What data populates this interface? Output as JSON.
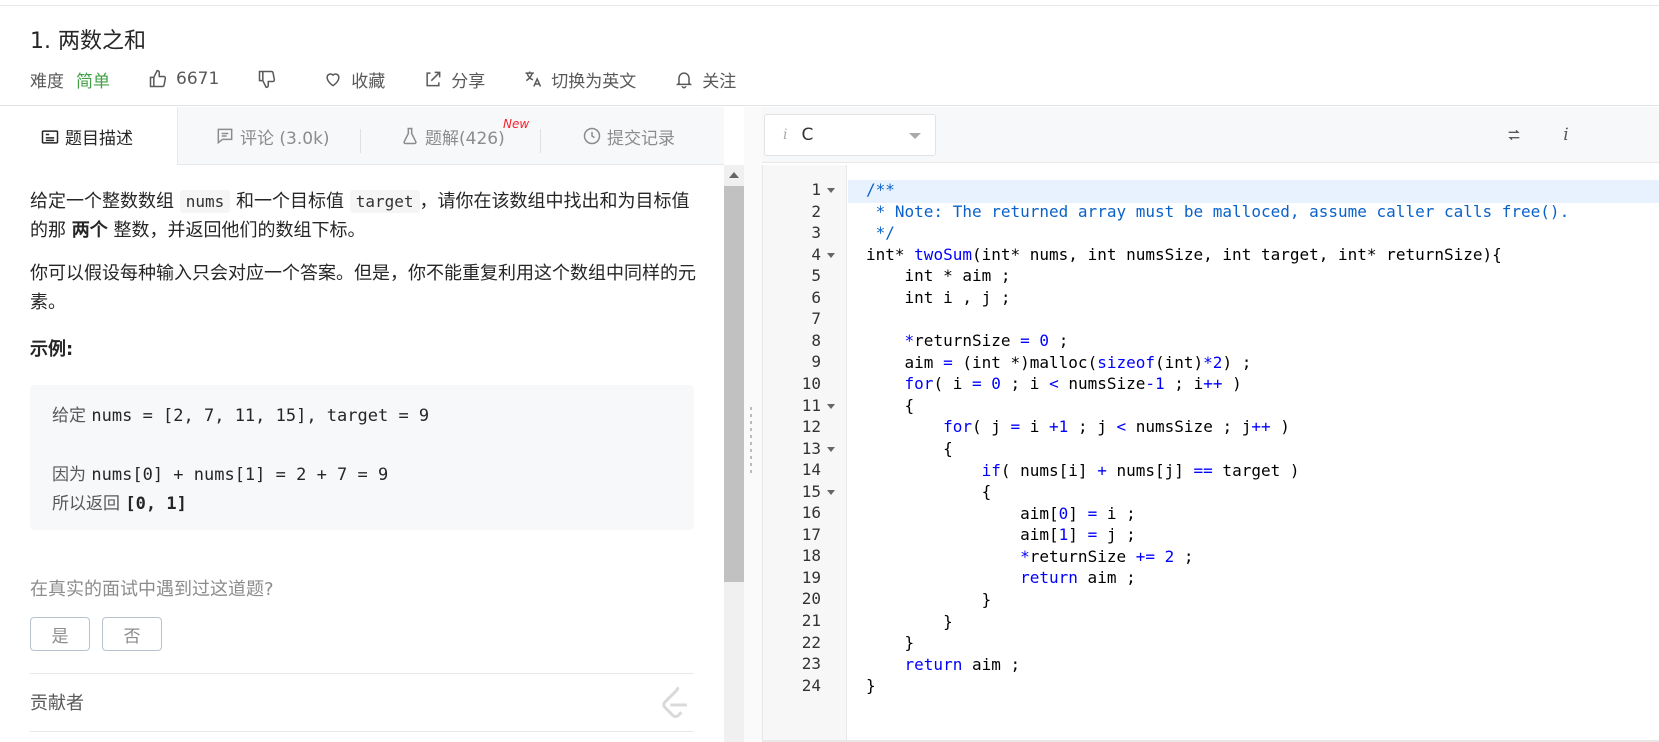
{
  "problem": {
    "title": "1. 两数之和",
    "difficulty_label": "难度",
    "difficulty_value": "简单",
    "likes": "6671",
    "favorite_label": "收藏",
    "share_label": "分享",
    "switch_lang_label": "切换为英文",
    "follow_label": "关注"
  },
  "tabs": [
    {
      "label": "题目描述"
    },
    {
      "label": "评论 (3.0k)"
    },
    {
      "label": "题解(426)",
      "badge": "New"
    },
    {
      "label": "提交记录"
    }
  ],
  "description": {
    "p1_a": "给定一个整数数组 ",
    "p1_code1": "nums",
    "p1_b": " 和一个目标值 ",
    "p1_code2": "target",
    "p1_c": "，请你在该数组中找出和为目标值的那 ",
    "p1_bold": "两个",
    "p1_d": " 整数，并返回他们的数组下标。",
    "p2": "你可以假设每种输入只会对应一个答案。但是，你不能重复利用这个数组中同样的元素。",
    "example_title": "示例:",
    "example": {
      "l1_zh": "给定 ",
      "l1_code": "nums = [2, 7, 11, 15], target = 9",
      "l2_zh": "因为 ",
      "l2_code": "nums[0] + nums[1] = 2 + 7 = 9",
      "l3_zh": "所以返回 ",
      "l3_code": "[0, 1]"
    },
    "question": "在真实的面试中遇到过这道题?",
    "yes": "是",
    "no": "否",
    "contributors": "贡献者"
  },
  "editor": {
    "language": "C",
    "line_numbers": [
      "1",
      "2",
      "3",
      "4",
      "5",
      "6",
      "7",
      "8",
      "9",
      "10",
      "11",
      "12",
      "13",
      "14",
      "15",
      "16",
      "17",
      "18",
      "19",
      "20",
      "21",
      "22",
      "23",
      "24"
    ],
    "fold_lines": [
      1,
      4,
      11,
      13,
      15
    ],
    "code": {
      "l1": "/**",
      "l2": " * Note: The returned array must be malloced, assume caller calls free().",
      "l3": " */",
      "l4_a": "int* ",
      "l4_b": "twoSum",
      "l4_c": "(int* nums, int numsSize, int target, int* returnSize){",
      "l5": "    int * aim ;",
      "l6": "    int i , j ;",
      "l8_a": "    ",
      "l8_b": "*",
      "l8_c": "returnSize ",
      "l8_d": "=",
      "l8_e": " ",
      "l8_f": "0",
      "l8_g": " ;",
      "l9_a": "    aim ",
      "l9_b": "=",
      "l9_c": " (int *)malloc(",
      "l9_d": "sizeof",
      "l9_e": "(int)",
      "l9_f": "*2",
      "l9_g": ") ;",
      "l10_a": "    ",
      "l10_b": "for",
      "l10_c": "( i ",
      "l10_d": "=",
      "l10_e": " ",
      "l10_f": "0",
      "l10_g": " ; i ",
      "l10_h": "<",
      "l10_i": " numsSize",
      "l10_j": "-1",
      "l10_k": " ; i",
      "l10_l": "++",
      "l10_m": " )",
      "l11": "    {",
      "l12_a": "        ",
      "l12_b": "for",
      "l12_c": "( j ",
      "l12_d": "=",
      "l12_e": " i ",
      "l12_f": "+1",
      "l12_g": " ; j ",
      "l12_h": "<",
      "l12_i": " numsSize ; j",
      "l12_j": "++",
      "l12_k": " )",
      "l13": "        {",
      "l14_a": "            ",
      "l14_b": "if",
      "l14_c": "( nums[i] ",
      "l14_d": "+",
      "l14_e": " nums[j] ",
      "l14_f": "==",
      "l14_g": " target )",
      "l15": "            {",
      "l16_a": "                aim[",
      "l16_b": "0",
      "l16_c": "] ",
      "l16_d": "=",
      "l16_e": " i ;",
      "l17_a": "                aim[",
      "l17_b": "1",
      "l17_c": "] ",
      "l17_d": "=",
      "l17_e": " j ;",
      "l18_a": "                ",
      "l18_b": "*",
      "l18_c": "returnSize ",
      "l18_d": "+=",
      "l18_e": " ",
      "l18_f": "2",
      "l18_g": " ;",
      "l19_a": "                ",
      "l19_b": "return",
      "l19_c": " aim ;",
      "l20": "            }",
      "l21": "        }",
      "l22": "    }",
      "l23_a": "    ",
      "l23_b": "return",
      "l23_c": " aim ;",
      "l24": "}"
    }
  },
  "colors": {
    "accent_green": "#43a047",
    "comment_blue": "#0a62c9",
    "keyword_blue": "#0000ff",
    "new_badge_red": "#f5222d"
  }
}
